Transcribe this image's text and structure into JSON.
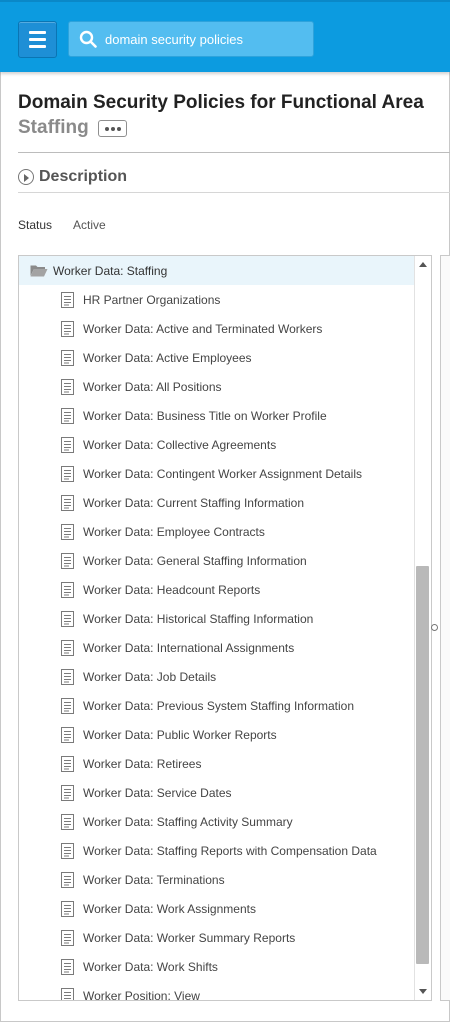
{
  "search": {
    "value": "domain security policies",
    "icon": "search-icon"
  },
  "page": {
    "title": "Domain Security Policies for Functional Area",
    "subtitle": "Staffing"
  },
  "description": {
    "label": "Description"
  },
  "status": {
    "label": "Status",
    "value": "Active"
  },
  "tree": {
    "root": "Worker Data: Staffing",
    "items": [
      "HR Partner Organizations",
      "Worker Data: Active and Terminated Workers",
      "Worker Data: Active Employees",
      "Worker Data: All Positions",
      "Worker Data: Business Title on Worker Profile",
      "Worker Data: Collective Agreements",
      "Worker Data: Contingent Worker Assignment Details",
      "Worker Data: Current Staffing Information",
      "Worker Data: Employee Contracts",
      "Worker Data: General Staffing Information",
      "Worker Data: Headcount Reports",
      "Worker Data: Historical Staffing Information",
      "Worker Data: International Assignments",
      "Worker Data: Job Details",
      "Worker Data: Previous System Staffing Information",
      "Worker Data: Public Worker Reports",
      "Worker Data: Retirees",
      "Worker Data: Service Dates",
      "Worker Data: Staffing Activity Summary",
      "Worker Data: Staffing Reports with Compensation Data",
      "Worker Data: Terminations",
      "Worker Data: Work Assignments",
      "Worker Data: Worker Summary Reports",
      "Worker Data: Work Shifts",
      "Worker Position: View"
    ]
  },
  "colors": {
    "header": "#0c9be0",
    "search_bg": "#53bdf0",
    "root_row": "#e9f5fb"
  }
}
